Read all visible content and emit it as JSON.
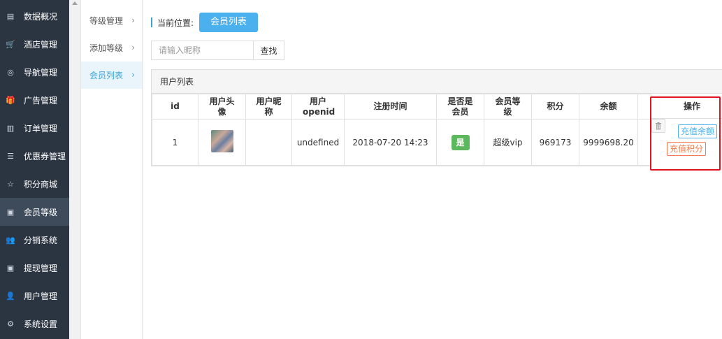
{
  "sidebar": {
    "items": [
      {
        "label": "数据概况",
        "icon": "dashboard-icon",
        "glyph": "▤"
      },
      {
        "label": "酒店管理",
        "icon": "cart-icon",
        "glyph": "🛒"
      },
      {
        "label": "导航管理",
        "icon": "compass-icon",
        "glyph": "◎"
      },
      {
        "label": "广告管理",
        "icon": "gift-icon",
        "glyph": "🎁"
      },
      {
        "label": "订单管理",
        "icon": "server-icon",
        "glyph": "▥"
      },
      {
        "label": "优惠券管理",
        "icon": "list-icon",
        "glyph": "☰"
      },
      {
        "label": "积分商城",
        "icon": "star-icon",
        "glyph": "☆"
      },
      {
        "label": "会员等级",
        "icon": "money-icon",
        "glyph": "▣"
      },
      {
        "label": "分销系统",
        "icon": "users-icon",
        "glyph": "👥"
      },
      {
        "label": "提现管理",
        "icon": "cash-icon",
        "glyph": "▣"
      },
      {
        "label": "用户管理",
        "icon": "user-icon",
        "glyph": "👤"
      },
      {
        "label": "系统设置",
        "icon": "gear-icon",
        "glyph": "⚙"
      }
    ],
    "active_index": 7
  },
  "subnav": {
    "items": [
      {
        "label": "等级管理"
      },
      {
        "label": "添加等级"
      },
      {
        "label": "会员列表"
      }
    ],
    "active_index": 2
  },
  "breadcrumb": {
    "label": "当前位置:",
    "current": "会员列表"
  },
  "search": {
    "placeholder": "请输入昵称",
    "button_label": "查找"
  },
  "panel": {
    "title": "用户列表"
  },
  "table": {
    "headers": {
      "id": "id",
      "avatar": "用户头像",
      "nickname": "用户昵称",
      "openid": "用户openid",
      "reg_time": "注册时间",
      "is_member": "是否是会员",
      "level": "会员等级",
      "points": "积分",
      "balance": "余额",
      "ops": "操作"
    },
    "rows": [
      {
        "id": "1",
        "nickname": "",
        "openid": "undefined",
        "reg_time": "2018-07-20 14:23",
        "is_member": "是",
        "level": "超级vip",
        "points": "969173",
        "balance": "9999698.20",
        "ops": {
          "recharge_balance": "充值余额",
          "recharge_points": "充值积分",
          "delete_icon": "trash-icon"
        }
      }
    ]
  },
  "colors": {
    "sidebar_bg": "#2b3542",
    "accent_blue": "#4ab0ee",
    "member_green": "#5cb85c",
    "points_orange": "#ee7e4f",
    "highlight_red": "#e0141e"
  }
}
